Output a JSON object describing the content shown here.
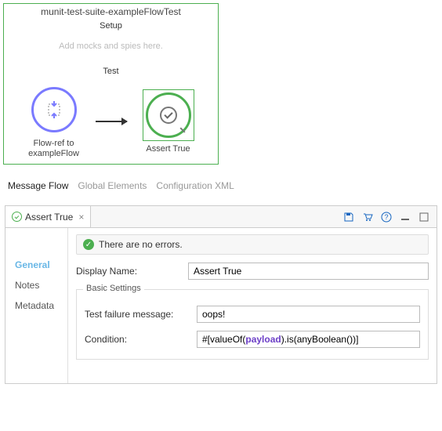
{
  "canvas": {
    "suite_title": "munit-test-suite-exampleFlowTest",
    "setup_label": "Setup",
    "setup_hint": "Add mocks and spies here.",
    "test_label": "Test",
    "nodes": {
      "flowref_label": "Flow-ref to exampleFlow",
      "assert_label": "Assert True"
    }
  },
  "upper_tabs": {
    "flow": "Message Flow",
    "globals": "Global Elements",
    "xml": "Configuration XML"
  },
  "panel": {
    "tab_title": "Assert True",
    "status_text": "There are no errors.",
    "side": {
      "general": "General",
      "notes": "Notes",
      "metadata": "Metadata"
    },
    "display_name_label": "Display Name:",
    "display_name_value": "Assert True",
    "basic_settings_label": "Basic Settings",
    "failure_label": "Test failure message:",
    "failure_value": "oops!",
    "condition_label": "Condition:",
    "condition_prefix": "#[valueOf(",
    "condition_kw": "payload",
    "condition_suffix": ").is(anyBoolean())]"
  }
}
